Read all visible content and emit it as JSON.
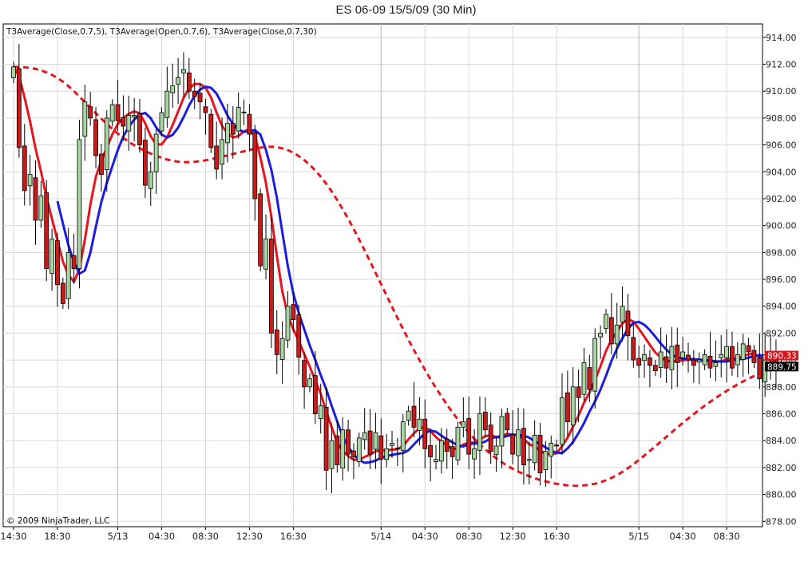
{
  "title": "ES 06-09  15/5/09 (30 Min)",
  "indicator_label": "T3Average(Close,0.7,5), T3Average(Open,0.7,6), T3Average(Close,0.7,30)",
  "copyright": "© 2009 NinjaTrader, LLC",
  "price_tags": {
    "red": "890.33",
    "black": "889.75"
  },
  "colors": {
    "up_candle": "#a8d5a0",
    "down_candle": "#cc1a1a",
    "red_line": "#e8141e",
    "blue_line": "#1c1ce0",
    "grid": "#d8d8d8",
    "session_grid": "#b8b8b8"
  },
  "chart_data": {
    "type": "candlestick",
    "y_unit": "price",
    "ylim": [
      877.6,
      915.0
    ],
    "y_ticks": [
      "914.00",
      "912.00",
      "910.00",
      "908.00",
      "906.00",
      "904.00",
      "902.00",
      "900.00",
      "898.00",
      "896.00",
      "894.00",
      "892.00",
      "890.00",
      "888.00",
      "886.00",
      "884.00",
      "882.00",
      "880.00",
      "878.00"
    ],
    "x_ticks": [
      {
        "bar": 0,
        "label": "14:30"
      },
      {
        "bar": 8,
        "label": "18:30"
      },
      {
        "bar": 19,
        "label": "5/13"
      },
      {
        "bar": 27,
        "label": "04:30"
      },
      {
        "bar": 35,
        "label": "08:30"
      },
      {
        "bar": 43,
        "label": "12:30"
      },
      {
        "bar": 51,
        "label": "16:30"
      },
      {
        "bar": 67,
        "label": "5/14"
      },
      {
        "bar": 75,
        "label": "04:30"
      },
      {
        "bar": 83,
        "label": "08:30"
      },
      {
        "bar": 91,
        "label": "12:30"
      },
      {
        "bar": 99,
        "label": "16:30"
      },
      {
        "bar": 114,
        "label": "5/15"
      },
      {
        "bar": 122,
        "label": "04:30"
      },
      {
        "bar": 130,
        "label": "08:30"
      }
    ],
    "session_breaks": [
      19,
      67,
      114
    ],
    "grid": true,
    "candles_close": [
      911.8,
      905.8,
      902.6,
      903.8,
      900.4,
      902.2,
      896.8,
      899.0,
      895.6,
      894.2,
      898.0,
      896.8,
      906.4,
      909.2,
      908.0,
      905.2,
      903.8,
      908.0,
      909.0,
      907.8,
      907.4,
      908.2,
      908.2,
      906.0,
      903.0,
      904.0,
      906.8,
      908.4,
      910.0,
      910.4,
      911.0,
      911.6,
      910.0,
      909.6,
      909.2,
      908.4,
      905.8,
      904.2,
      906.4,
      907.6,
      906.8,
      908.8,
      908.4,
      906.8,
      902.0,
      897.0,
      899.0,
      892.0,
      890.4,
      891.6,
      894.0,
      893.0,
      890.2,
      888.0,
      888.6,
      886.0,
      886.6,
      881.8,
      884.0,
      882.2,
      884.8,
      883.0,
      882.8,
      884.2,
      884.6,
      883.0,
      884.6,
      882.6,
      883.4,
      883.8,
      883.4,
      885.4,
      886.2,
      885.0,
      885.6,
      883.4,
      882.8,
      882.6,
      884.0,
      883.2,
      882.8,
      885.0,
      885.4,
      883.0,
      883.4,
      886.0,
      884.8,
      883.2,
      883.6,
      885.8,
      884.8,
      883.0,
      884.8,
      882.2,
      882.6,
      884.4,
      881.6,
      883.2,
      883.8,
      883.6,
      887.2,
      885.4,
      888.0,
      887.2,
      889.8,
      887.8,
      891.6,
      892.0,
      893.4,
      891.2,
      892.6,
      894.0,
      891.8,
      890.0,
      889.6,
      890.4,
      889.6,
      889.2,
      890.6,
      889.4,
      891.0,
      889.8,
      890.6,
      890.0,
      889.6,
      890.0,
      890.4,
      889.4,
      889.8,
      890.4,
      891.0,
      889.4,
      890.4,
      891.2,
      890.6,
      889.8,
      888.6,
      890.4,
      890.0,
      889.75
    ]
  }
}
